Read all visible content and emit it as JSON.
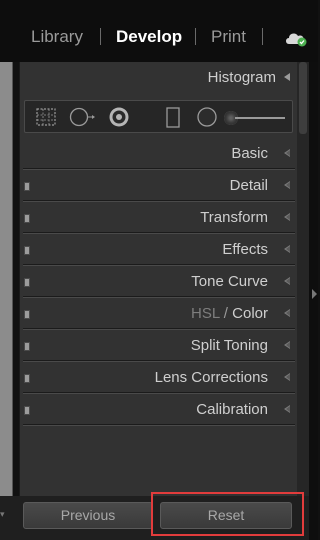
{
  "module_picker": {
    "items": [
      {
        "label": "Library",
        "active": false
      },
      {
        "label": "Develop",
        "active": true
      },
      {
        "label": "Print",
        "active": false
      }
    ],
    "separator": "|",
    "cloud_icon": "cloud-sync-icon",
    "cloud_status_color": "#4caf50"
  },
  "panels": {
    "histogram": {
      "label": "Histogram"
    },
    "sections": [
      {
        "label": "Basic",
        "has_switch": false
      },
      {
        "label": "Detail",
        "has_switch": true
      },
      {
        "label": "Transform",
        "has_switch": true
      },
      {
        "label": "Effects",
        "has_switch": true
      },
      {
        "label": "Tone Curve",
        "has_switch": true
      },
      {
        "label_dim": "HSL",
        "label_sep": "/",
        "label": "Color",
        "has_switch": true
      },
      {
        "label": "Split Toning",
        "has_switch": true
      },
      {
        "label": "Lens Corrections",
        "has_switch": true
      },
      {
        "label": "Calibration",
        "has_switch": true
      }
    ]
  },
  "toolstrip": {
    "tools": [
      "crop-overlay-icon",
      "spot-removal-icon",
      "red-eye-icon",
      "graduated-filter-icon",
      "radial-filter-icon",
      "adjustment-brush-icon"
    ]
  },
  "buttons": {
    "previous": "Previous",
    "reset": "Reset"
  },
  "highlight_color": "#e23c3c"
}
